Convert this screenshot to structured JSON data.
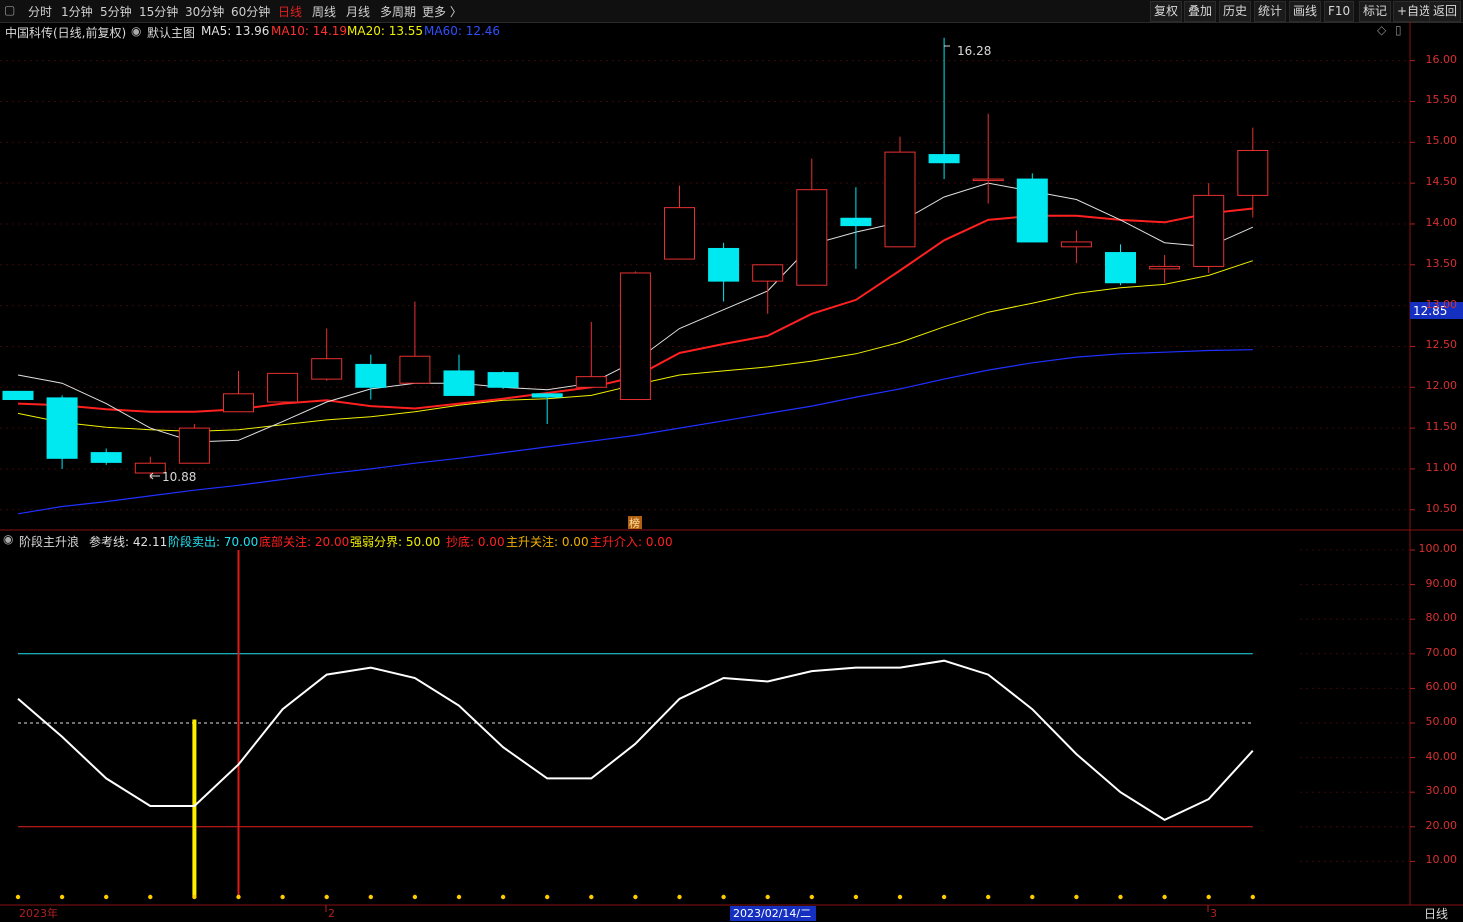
{
  "toolbar": {
    "periods": [
      "分时",
      "1分钟",
      "5分钟",
      "15分钟",
      "30分钟",
      "60分钟",
      "日线",
      "周线",
      "月线",
      "多周期",
      "更多 〉"
    ],
    "active_period": "日线",
    "right_buttons": [
      "复权",
      "叠加",
      "历史",
      "统计",
      "画线",
      "F10",
      "标记",
      "+自选",
      "返回"
    ]
  },
  "main_chart": {
    "stock_title": "中国科传(日线,前复权)",
    "template": "默认主图",
    "ma5": "MA5: 13.96",
    "ma10": "MA10: 14.19",
    "ma20": "MA20: 13.55",
    "ma60": "MA60: 12.46",
    "high_label": "16.28",
    "low_label": "10.88",
    "current_price": "12.85",
    "marker_char": "榜",
    "y_labels": [
      "16.00",
      "15.50",
      "15.00",
      "14.50",
      "14.00",
      "13.50",
      "13.00",
      "12.50",
      "12.00",
      "11.50",
      "11.00",
      "10.50"
    ],
    "colors": {
      "up": "#e83030",
      "down": "#00e8f0",
      "ma5": "#e0e0e0",
      "ma10": "#ff2020",
      "ma20": "#f0f000",
      "ma60": "#2030ff"
    }
  },
  "indicator": {
    "name": "阶段主升浪",
    "ref": "参考线: 42.11",
    "sell": "阶段卖出: 70.00",
    "bottom": "底部关注: 20.00",
    "divide": "强弱分界: 50.00",
    "buy_bottom": "抄底: 0.00",
    "main_focus": "主升关注: 0.00",
    "main_enter": "主升介入: 0.00",
    "y_labels": [
      "100.00",
      "90.00",
      "80.00",
      "70.00",
      "60.00",
      "50.00",
      "40.00",
      "30.00",
      "20.00",
      "10.00"
    ]
  },
  "x_axis": {
    "labels": [
      "2023年",
      "2",
      "2023/02/14/二",
      "3"
    ],
    "period_label": "日线"
  },
  "chart_data": {
    "type": "candlestick",
    "candles": [
      {
        "o": 11.95,
        "h": 11.95,
        "l": 11.85,
        "c": 11.85
      },
      {
        "o": 11.87,
        "h": 11.9,
        "l": 11.0,
        "c": 11.13
      },
      {
        "o": 11.2,
        "h": 11.25,
        "l": 11.05,
        "c": 11.08
      },
      {
        "o": 10.95,
        "h": 11.15,
        "l": 10.88,
        "c": 11.07
      },
      {
        "o": 11.07,
        "h": 11.55,
        "l": 11.07,
        "c": 11.5
      },
      {
        "o": 11.7,
        "h": 12.2,
        "l": 11.7,
        "c": 11.92
      },
      {
        "o": 11.82,
        "h": 12.17,
        "l": 11.82,
        "c": 12.17
      },
      {
        "o": 12.1,
        "h": 12.72,
        "l": 12.08,
        "c": 12.35
      },
      {
        "o": 12.28,
        "h": 12.4,
        "l": 11.85,
        "c": 12.0
      },
      {
        "o": 12.05,
        "h": 13.05,
        "l": 12.05,
        "c": 12.38
      },
      {
        "o": 12.2,
        "h": 12.4,
        "l": 11.9,
        "c": 11.9
      },
      {
        "o": 12.18,
        "h": 12.2,
        "l": 11.98,
        "c": 12.0
      },
      {
        "o": 11.92,
        "h": 11.92,
        "l": 11.55,
        "c": 11.88
      },
      {
        "o": 12.0,
        "h": 12.8,
        "l": 12.0,
        "c": 12.13
      },
      {
        "o": 11.85,
        "h": 13.42,
        "l": 11.85,
        "c": 13.4
      },
      {
        "o": 13.57,
        "h": 14.47,
        "l": 13.57,
        "c": 14.2
      },
      {
        "o": 13.7,
        "h": 13.77,
        "l": 13.05,
        "c": 13.3
      },
      {
        "o": 13.3,
        "h": 13.5,
        "l": 12.9,
        "c": 13.5
      },
      {
        "o": 13.25,
        "h": 14.8,
        "l": 13.25,
        "c": 14.42
      },
      {
        "o": 14.07,
        "h": 14.45,
        "l": 13.45,
        "c": 13.98
      },
      {
        "o": 13.72,
        "h": 15.07,
        "l": 13.72,
        "c": 14.88
      },
      {
        "o": 14.85,
        "h": 16.28,
        "l": 14.55,
        "c": 14.75
      },
      {
        "o": 14.55,
        "h": 15.35,
        "l": 14.25,
        "c": 14.55
      },
      {
        "o": 14.55,
        "h": 14.62,
        "l": 13.78,
        "c": 13.78
      },
      {
        "o": 13.72,
        "h": 13.92,
        "l": 13.52,
        "c": 13.78
      },
      {
        "o": 13.65,
        "h": 13.75,
        "l": 13.25,
        "c": 13.28
      },
      {
        "o": 13.45,
        "h": 13.62,
        "l": 13.28,
        "c": 13.48
      },
      {
        "o": 13.48,
        "h": 14.5,
        "l": 13.4,
        "c": 14.35
      },
      {
        "o": 14.35,
        "h": 15.18,
        "l": 14.08,
        "c": 14.9
      }
    ],
    "ma5": [
      12.15,
      12.05,
      11.8,
      11.5,
      11.33,
      11.35,
      11.58,
      11.82,
      11.98,
      12.05,
      12.05,
      12.0,
      11.97,
      12.05,
      12.32,
      12.72,
      12.95,
      13.18,
      13.75,
      13.9,
      14.02,
      14.33,
      14.5,
      14.4,
      14.3,
      14.05,
      13.77,
      13.72,
      13.96
    ],
    "ma10": [
      11.8,
      11.78,
      11.73,
      11.7,
      11.7,
      11.73,
      11.8,
      11.84,
      11.77,
      11.74,
      11.8,
      11.86,
      11.93,
      12.0,
      12.13,
      12.42,
      12.53,
      12.63,
      12.9,
      13.07,
      13.43,
      13.8,
      14.05,
      14.1,
      14.1,
      14.05,
      14.02,
      14.13,
      14.19
    ],
    "ma20": [
      11.68,
      11.57,
      11.51,
      11.48,
      11.46,
      11.48,
      11.54,
      11.6,
      11.64,
      11.7,
      11.78,
      11.84,
      11.86,
      11.9,
      12.03,
      12.15,
      12.2,
      12.25,
      12.32,
      12.41,
      12.55,
      12.74,
      12.92,
      13.03,
      13.15,
      13.22,
      13.26,
      13.37,
      13.55
    ],
    "ma60": [
      10.45,
      10.54,
      10.6,
      10.67,
      10.74,
      10.8,
      10.87,
      10.94,
      11.0,
      11.07,
      11.13,
      11.2,
      11.27,
      11.34,
      11.41,
      11.5,
      11.59,
      11.68,
      11.77,
      11.88,
      11.98,
      12.1,
      12.21,
      12.3,
      12.37,
      12.41,
      12.43,
      12.45,
      12.46
    ],
    "indicator_values": [
      57,
      46,
      34,
      26,
      26,
      38,
      54,
      64,
      66,
      63,
      55,
      43,
      34,
      34,
      44,
      57,
      63,
      62,
      65,
      66,
      66,
      68,
      64,
      54,
      41,
      30,
      22,
      28,
      42
    ],
    "signals": [
      {
        "index": 4,
        "type": "yellow-bar",
        "from": 0,
        "to": 51
      },
      {
        "index": 5,
        "type": "red-bar",
        "from": 0,
        "to": 100
      }
    ],
    "ylim_price": [
      10.35,
      16.4
    ],
    "ylim_indicator": [
      0,
      100
    ]
  }
}
